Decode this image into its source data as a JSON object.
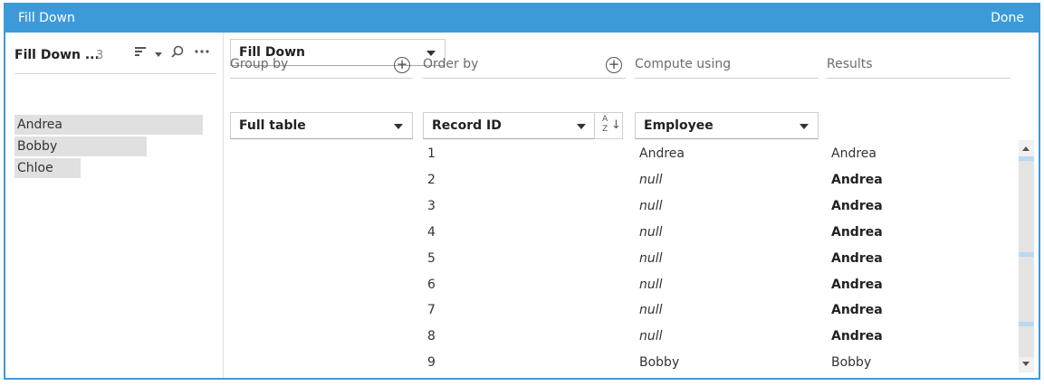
{
  "header": {
    "title": "Fill Down",
    "done_label": "Done"
  },
  "left": {
    "field_name": "Fill Down ...",
    "count": "3",
    "icons": {
      "sort": "sort-lines-icon",
      "dropdown": "caret-down-icon",
      "search": "search-icon",
      "more": "more-icon"
    },
    "values": [
      {
        "label": "Andrea",
        "fraction": 1.0
      },
      {
        "label": "Bobby",
        "fraction": 0.7
      },
      {
        "label": "Chloe",
        "fraction": 0.35
      }
    ]
  },
  "calc_type": "Fill Down",
  "group_by": {
    "label": "Group by",
    "value": "Full table"
  },
  "order_by": {
    "label": "Order by",
    "value": "Record ID"
  },
  "compute_using": {
    "label": "Compute using",
    "value": "Employee"
  },
  "results": {
    "label": "Results"
  },
  "rows": [
    {
      "id": "1",
      "employee": "Andrea",
      "result": "Andrea"
    },
    {
      "id": "2",
      "employee": "null",
      "result": "Andrea"
    },
    {
      "id": "3",
      "employee": "null",
      "result": "Andrea"
    },
    {
      "id": "4",
      "employee": "null",
      "result": "Andrea"
    },
    {
      "id": "5",
      "employee": "null",
      "result": "Andrea"
    },
    {
      "id": "6",
      "employee": "null",
      "result": "Andrea"
    },
    {
      "id": "7",
      "employee": "null",
      "result": "Andrea"
    },
    {
      "id": "8",
      "employee": "null",
      "result": "Andrea"
    },
    {
      "id": "9",
      "employee": "Bobby",
      "result": "Bobby"
    }
  ],
  "colors": {
    "accent": "#3d9ad9",
    "bar": "#e0e0e0"
  }
}
